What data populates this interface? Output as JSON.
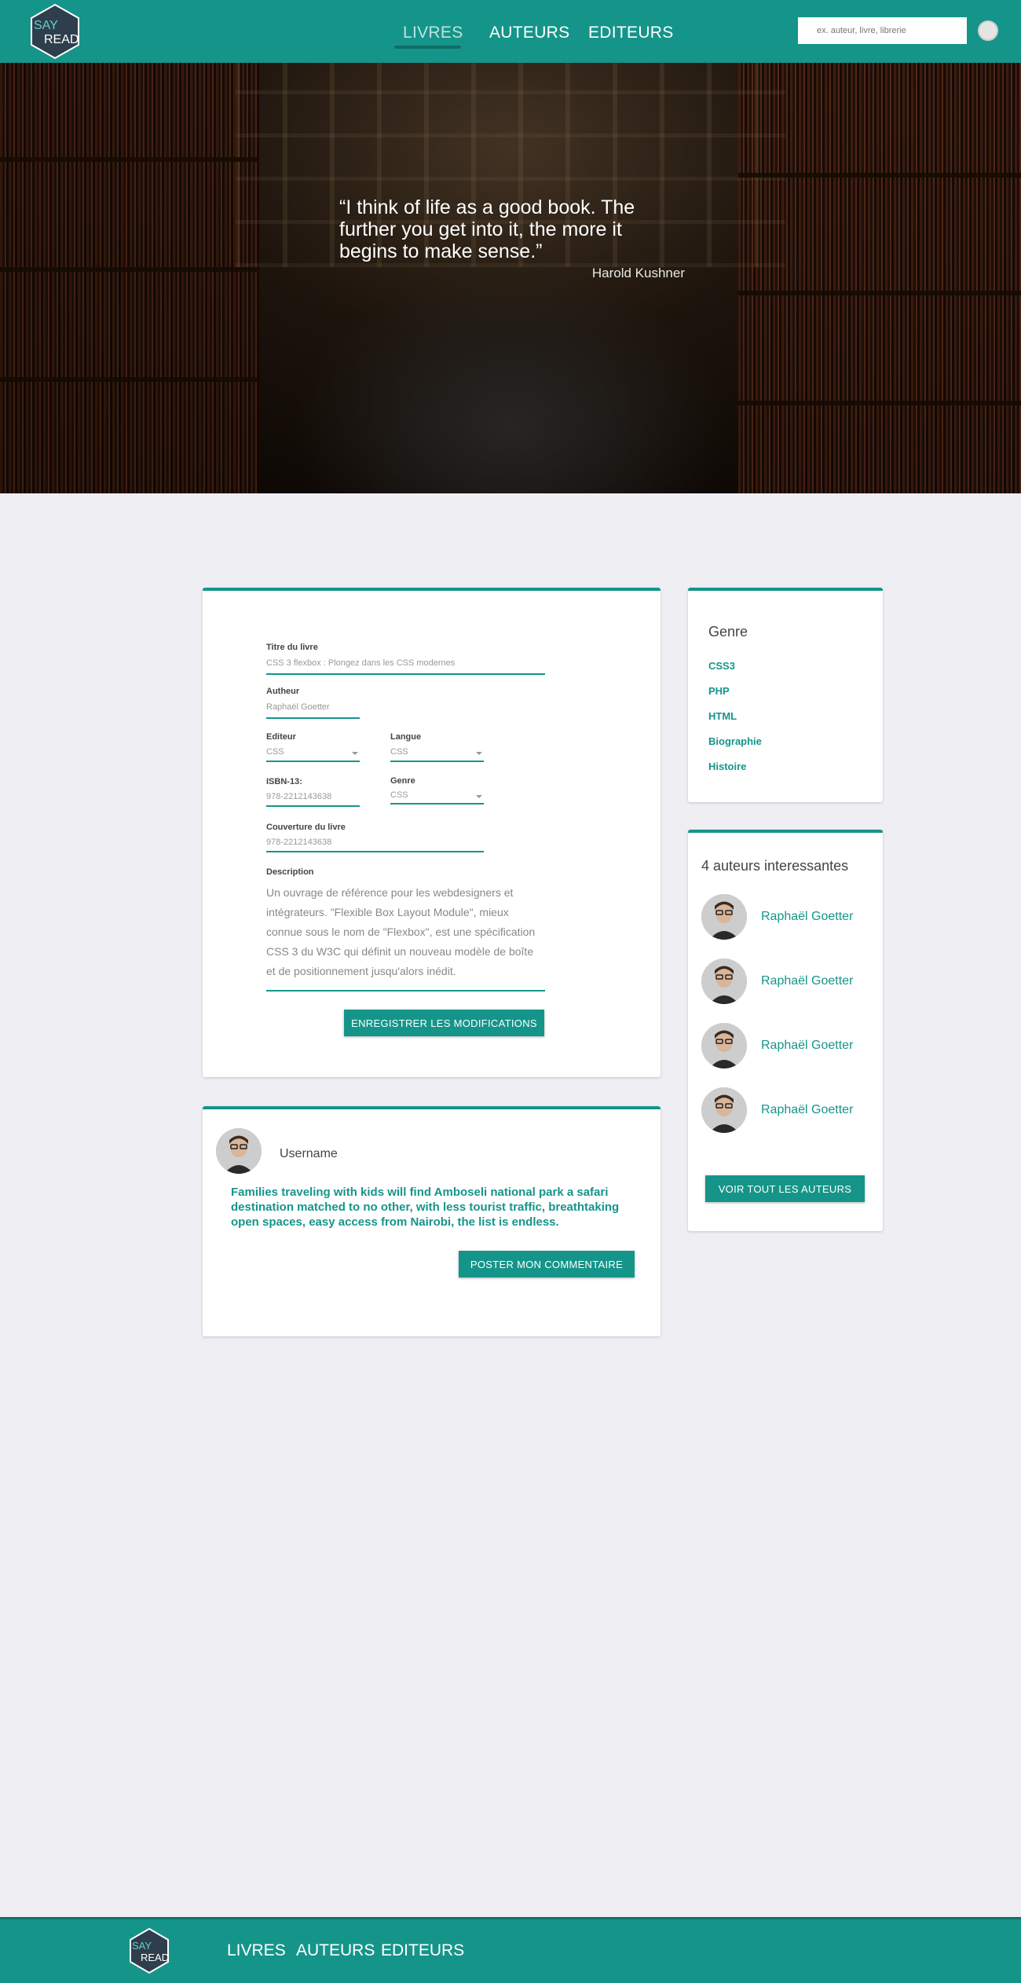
{
  "header": {
    "logo": {
      "say": "SAY",
      "read": "READ"
    },
    "nav": [
      {
        "label": "LIVRES",
        "active": true
      },
      {
        "label": "AUTEURS",
        "active": false
      },
      {
        "label": "EDITEURS",
        "active": false
      }
    ],
    "search_placeholder": "ex. auteur, livre, librerie"
  },
  "hero": {
    "quote": "“I think of life as a good book. The further you get into it, the more it begins to make sense.”",
    "author": "Harold Kushner"
  },
  "form": {
    "title_label": "Titre du livre",
    "title_value": "CSS 3 flexbox : Plongez dans les CSS modernes",
    "author_label": "Autheur",
    "author_value": "Raphaël Goetter",
    "publisher_label": "Editeur",
    "publisher_value": "CSS",
    "language_label": "Langue",
    "language_value": "CSS",
    "isbn_label": "ISBN-13:",
    "isbn_value": "978-2212143638",
    "genre_label": "Genre",
    "genre_value": "CSS",
    "cover_label": "Couverture du livre",
    "cover_value": "978-2212143638",
    "description_label": "Description",
    "description_value": "Un ouvrage de référence pour les webdesigners et intégrateurs. \"Flexible Box Layout Module\", mieux connue sous le nom de \"Flexbox\", est une spécification CSS 3 du W3C qui définit un nouveau modèle de boîte et de positionnement jusqu'alors inédit.",
    "save_label": "ENREGISTRER LES MODIFICATIONS"
  },
  "comment": {
    "username": "Username",
    "text": "Families traveling with kids will find Amboseli national park a safari destination matched to no other, with less tourist traffic, breathtaking open spaces, easy access from Nairobi, the list is endless.",
    "post_label": "POSTER MON COMMENTAIRE"
  },
  "genres": {
    "title": "Genre",
    "items": [
      "CSS3",
      "PHP",
      "HTML",
      "Biographie",
      "Histoire"
    ]
  },
  "authors": {
    "title": "4 auteurs interessantes",
    "items": [
      "Raphaël Goetter",
      "Raphaël Goetter",
      "Raphaël Goetter",
      "Raphaël Goetter"
    ],
    "see_all_label": "VOIR TOUT LES AUTEURS"
  },
  "footer": {
    "logo": {
      "say": "SAY",
      "read": "READ"
    },
    "nav": [
      "LIVRES",
      "AUTEURS",
      "EDITEURS"
    ]
  },
  "colors": {
    "accent": "#15958a",
    "background": "#efeff3",
    "logo_dark": "#2f3e4c"
  }
}
